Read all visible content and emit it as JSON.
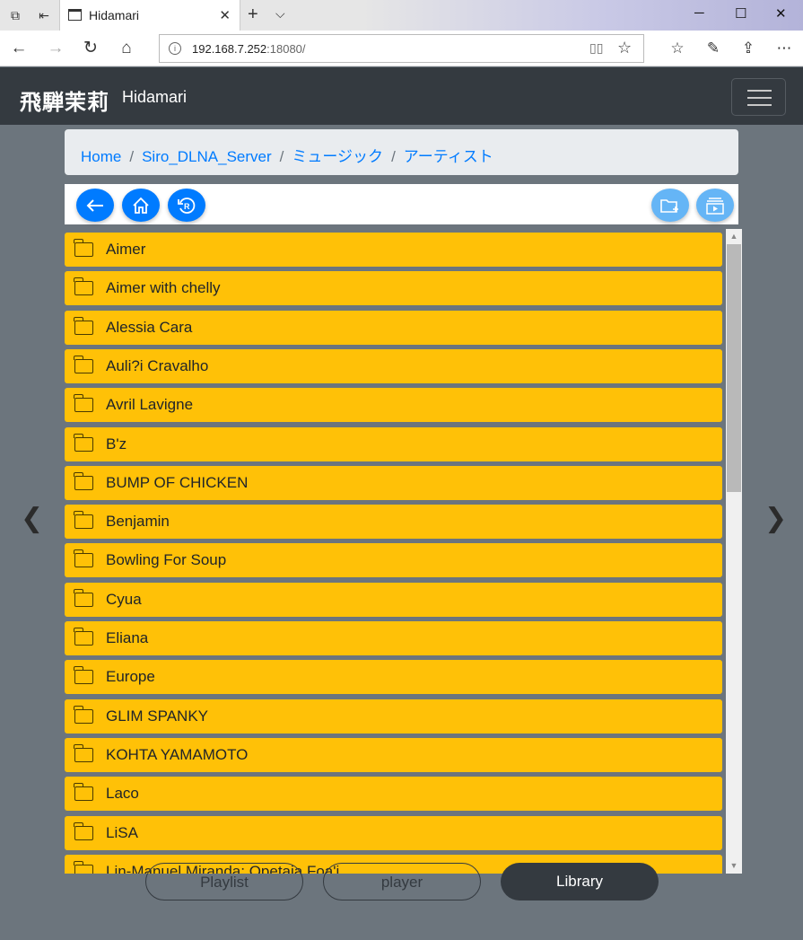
{
  "browser": {
    "tab_title": "Hidamari",
    "url_host": "192.168.7.252",
    "url_port": ":18080/",
    "new_tab_symbol": "+",
    "tab_close_symbol": "✕"
  },
  "navbar": {
    "brand_kanji": "飛騨茉莉",
    "brand_name": "Hidamari"
  },
  "breadcrumb": [
    "Home",
    "Siro_DLNA_Server",
    "ミュージック",
    "アーティスト"
  ],
  "breadcrumb_separator": "/",
  "folders": [
    "Aimer",
    "Aimer with chelly",
    "Alessia Cara",
    "Auli?i Cravalho",
    "Avril Lavigne",
    "B'z",
    "BUMP OF CHICKEN",
    "Benjamin",
    "Bowling For Soup",
    "Cyua",
    "Eliana",
    "Europe",
    "GLIM SPANKY",
    "KOHTA YAMAMOTO",
    "Laco",
    "LiSA",
    "Lin-Manuel Miranda; Opetaia Foa'i"
  ],
  "bottom_tabs": {
    "playlist": "Playlist",
    "player": "player",
    "library": "Library"
  },
  "icons": {
    "back": "back-arrow-icon",
    "home": "home-icon",
    "refresh": "refresh-icon",
    "add_folder": "folder-add-icon",
    "play_list": "play-list-icon"
  },
  "colors": {
    "folder_item": "#ffc107",
    "navbar": "#343a40",
    "primary": "#007bff",
    "light_primary": "#65b5f6",
    "background": "#6c757d"
  }
}
